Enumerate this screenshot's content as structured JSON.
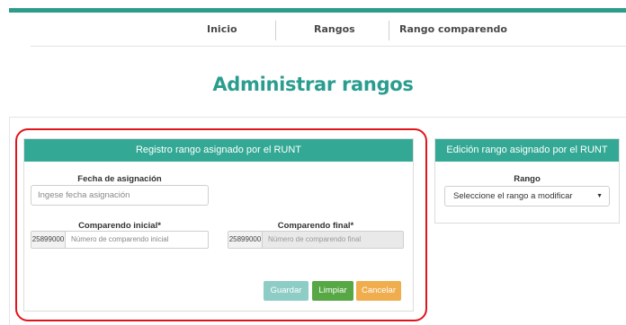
{
  "nav": {
    "items": [
      {
        "label": "Inicio"
      },
      {
        "label": "Rangos"
      },
      {
        "label": "Rango comparendo"
      }
    ]
  },
  "page": {
    "title": "Administrar rangos"
  },
  "registro_panel": {
    "header": "Registro rango asignado por el RUNT",
    "fecha": {
      "label": "Fecha de asignación",
      "placeholder": "Ingese fecha asignación"
    },
    "comparendo_inicial": {
      "label": "Comparendo inicial*",
      "prefix": "25899000",
      "placeholder": "Número de comparendo inicial"
    },
    "comparendo_final": {
      "label": "Comparendo final*",
      "prefix": "25899000",
      "placeholder": "Número de comparendo final"
    },
    "buttons": {
      "save": "Guardar",
      "clear": "Limpiar",
      "cancel": "Cancelar"
    }
  },
  "edicion_panel": {
    "header": "Edición rango asignado por el RUNT",
    "rango": {
      "label": "Rango",
      "selected": "Seleccione el rango a modificar"
    }
  },
  "colors": {
    "accent": "#2e9c8a",
    "header": "#33a894",
    "highlight": "#e0151b",
    "save": "#8ecdc6",
    "clear": "#57a845",
    "cancel": "#f0ad4e"
  }
}
